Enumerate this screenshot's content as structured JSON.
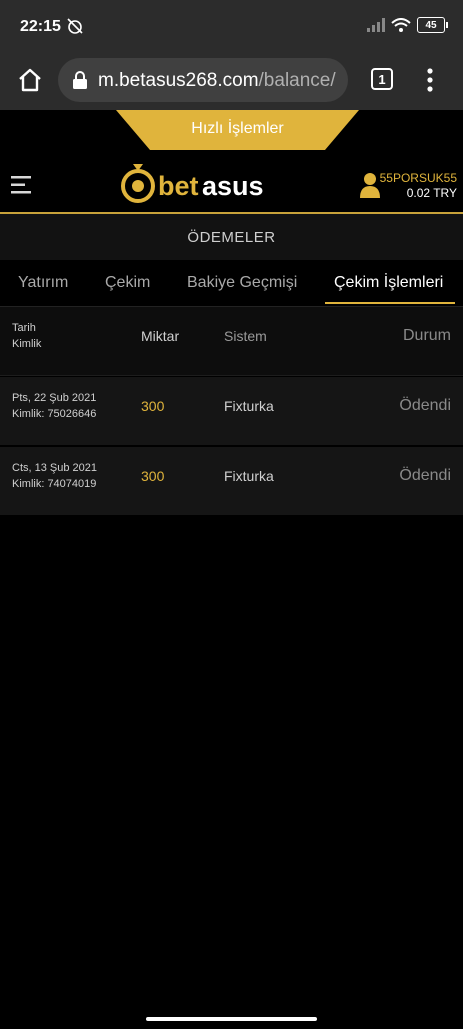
{
  "status_bar": {
    "time": "22:15",
    "battery": "45"
  },
  "browser": {
    "url_domain": "m.betasus268.com",
    "url_path": "/balance/",
    "tab_count": "1"
  },
  "quick_actions": {
    "label": "Hızlı İşlemler"
  },
  "header": {
    "logo_left": "bet",
    "logo_right": "asus",
    "username": "55PORSUK55",
    "balance": "0.02 TRY"
  },
  "page_title": "ÖDEMELER",
  "tabs": [
    {
      "label": "Yatırım",
      "active": false
    },
    {
      "label": "Çekim",
      "active": false
    },
    {
      "label": "Bakiye Geçmişi",
      "active": false
    },
    {
      "label": "Çekim İşlemleri",
      "active": true
    }
  ],
  "table": {
    "headers": {
      "date": "Tarih",
      "id": "Kimlik",
      "amount": "Miktar",
      "system": "Sistem",
      "status": "Durum"
    },
    "rows": [
      {
        "date": "Pts, 22 Şub 2021",
        "id": "Kimlik: 75026646",
        "amount": "300",
        "system": "Fixturka",
        "status": "Ödendi"
      },
      {
        "date": "Cts, 13 Şub 2021",
        "id": "Kimlik: 74074019",
        "amount": "300",
        "system": "Fixturka",
        "status": "Ödendi"
      }
    ]
  },
  "colors": {
    "accent": "#e0b43c",
    "bar": "#2c2c2c",
    "background": "#000000"
  }
}
